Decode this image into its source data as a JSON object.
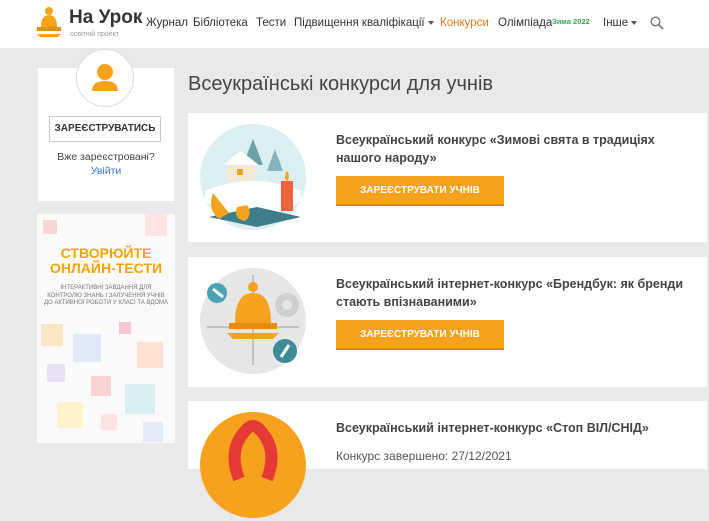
{
  "header": {
    "logo_title": "На Урок",
    "logo_subtitle": "освітній проект",
    "nav": [
      {
        "label": "Журнал"
      },
      {
        "label": "Бібліотека"
      },
      {
        "label": "Тести"
      },
      {
        "label": "Підвищення кваліфікації",
        "dropdown": true
      },
      {
        "label": "Конкурси",
        "active": true
      },
      {
        "label": "Олімпіада",
        "badge": "Зима 2022"
      },
      {
        "label": "Інше",
        "dropdown": true
      }
    ],
    "search_icon": "search-icon"
  },
  "sidebar": {
    "register_button": "ЗАРЕЄСТРУВАТИСЬ",
    "already_registered": "Вже зареєстровані?",
    "login_link": "Увійти"
  },
  "promo": {
    "title_line1": "СТВОРЮЙТЕ",
    "title_line2": "ОНЛАЙН-ТЕСТИ",
    "text": "ІНТЕРАКТИВНІ ЗАВДАННЯ ДЛЯ КОНТРОЛЮ ЗНАНЬ І ЗАЛУЧЕННЯ УЧНІВ ДО АКТИВНОЇ РОБОТИ У КЛАСІ ТА ВДОМА"
  },
  "main": {
    "page_title": "Всеукраїнські конкурси для учнів",
    "contests": [
      {
        "title": "Всеукраїнський конкурс «Зимові свята в традиціях нашого народу»",
        "button": "ЗАРЕЄСТРУВАТИ УЧНІВ"
      },
      {
        "title": "Всеукраїнський інтернет-конкурс «Брендбук: як бренди стають впізнаваними»",
        "button": "ЗАРЕЄСТРУВАТИ УЧНІВ"
      },
      {
        "title": "Всеукраїнський інтернет-конкурс «Стоп ВІЛ/СНІД»",
        "status": "Конкурс завершено: 27/12/2021"
      }
    ]
  },
  "colors": {
    "accent": "#f7a21e",
    "active_nav": "#e07a1f",
    "link": "#3b7bd6",
    "badge": "#34a853"
  }
}
